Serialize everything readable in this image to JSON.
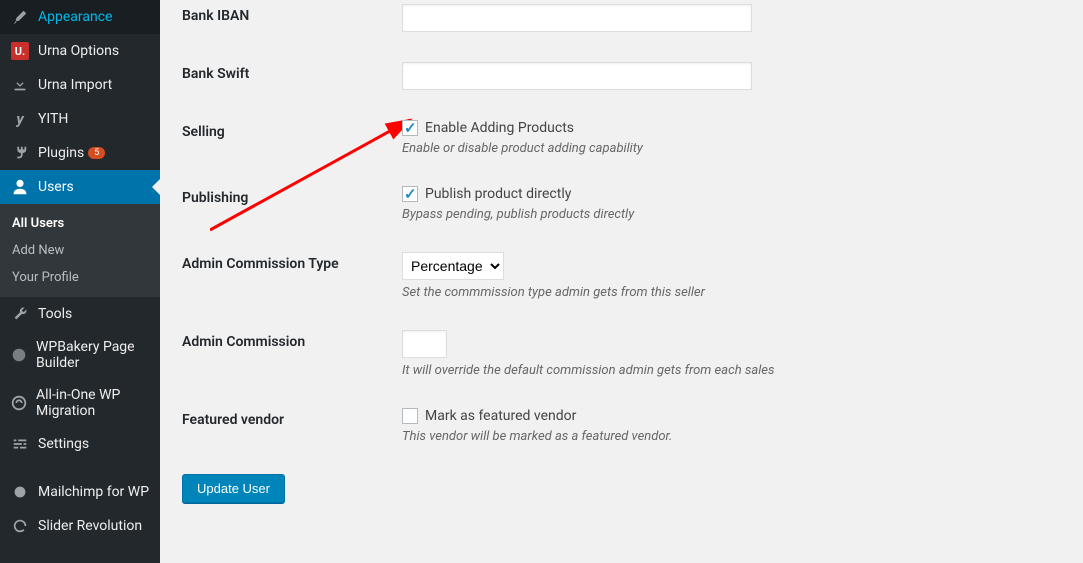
{
  "sidebar": {
    "items": [
      {
        "label": "Appearance"
      },
      {
        "label": "Urna Options"
      },
      {
        "label": "Urna Import"
      },
      {
        "label": "YITH"
      },
      {
        "label": "Plugins",
        "badge": "5"
      },
      {
        "label": "Users"
      },
      {
        "label": "Tools"
      },
      {
        "label": "WPBakery Page Builder"
      },
      {
        "label": "All-in-One WP Migration"
      },
      {
        "label": "Settings"
      },
      {
        "label": "Mailchimp for WP"
      },
      {
        "label": "Slider Revolution"
      }
    ],
    "sub": {
      "all_users": "All Users",
      "add_new": "Add New",
      "your_profile": "Your Profile"
    }
  },
  "form": {
    "bank_iban": {
      "label": "Bank IBAN",
      "value": ""
    },
    "bank_swift": {
      "label": "Bank Swift",
      "value": ""
    },
    "selling": {
      "label": "Selling",
      "checkbox_label": "Enable Adding Products",
      "desc": "Enable or disable product adding capability"
    },
    "publishing": {
      "label": "Publishing",
      "checkbox_label": "Publish product directly",
      "desc": "Bypass pending, publish products directly"
    },
    "commission_type": {
      "label": "Admin Commission Type",
      "selected": "Percentage",
      "desc": "Set the commmission type admin gets from this seller"
    },
    "commission": {
      "label": "Admin Commission",
      "value": "",
      "desc": "It will override the default commission admin gets from each sales"
    },
    "featured": {
      "label": "Featured vendor",
      "checkbox_label": "Mark as featured vendor",
      "desc": "This vendor will be marked as a featured vendor."
    },
    "submit": "Update User"
  }
}
